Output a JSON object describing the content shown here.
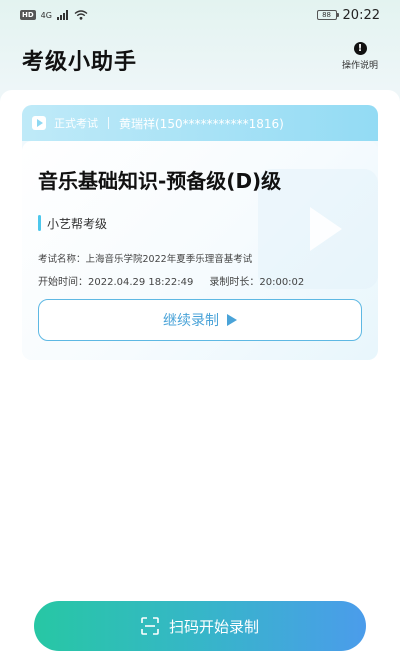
{
  "status_bar": {
    "hd": "HD",
    "network": "4G",
    "battery": "88",
    "time": "20:22"
  },
  "header": {
    "title": "考级小助手",
    "help_label": "操作说明",
    "help_icon": "exclamation-circle-icon"
  },
  "exam_card": {
    "exam_type": "正式考试",
    "candidate": "黄瑞祥(150***********1816)",
    "title": "音乐基础知识-预备级(D)级",
    "organization": "小艺帮考级",
    "exam_name_label": "考试名称：",
    "exam_name": "上海音乐学院2022年夏季乐理音基考试",
    "start_time_label": "开始时间：",
    "start_time": "2022.04.29 18:22:49",
    "duration_label": "录制时长：",
    "duration": "20:00:02",
    "continue_label": "继续录制"
  },
  "bottom": {
    "scan_label": "扫码开始录制"
  },
  "colors": {
    "accent_blue": "#4aa3d8",
    "header_blue": "#93dbf4",
    "gradient_start": "#27c7a4",
    "gradient_end": "#4b9ceb"
  }
}
